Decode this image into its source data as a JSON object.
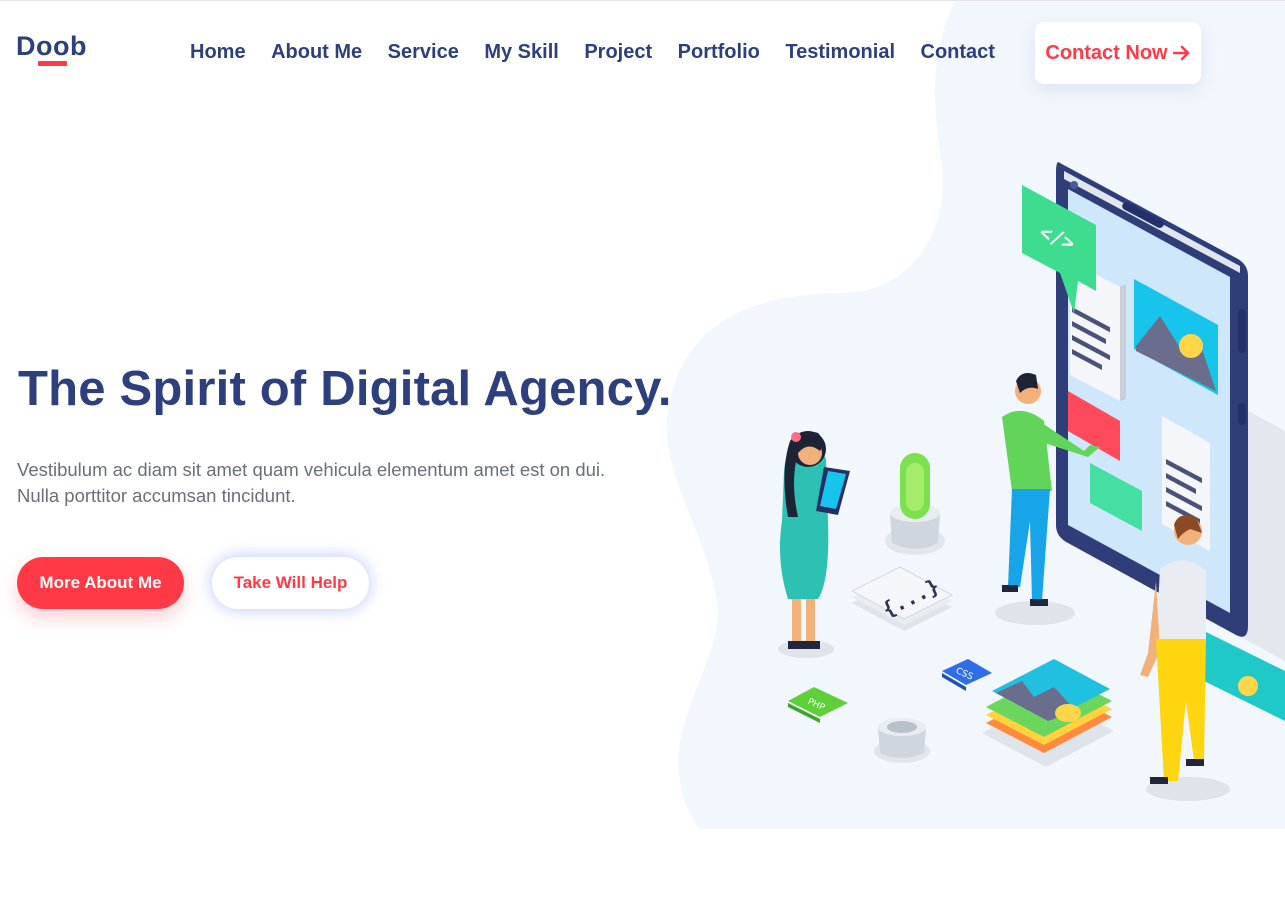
{
  "brand": {
    "name": "Doob"
  },
  "nav": {
    "items": [
      {
        "label": "Home"
      },
      {
        "label": "About Me"
      },
      {
        "label": "Service"
      },
      {
        "label": "My Skill"
      },
      {
        "label": "Project"
      },
      {
        "label": "Portfolio"
      },
      {
        "label": "Testimonial"
      },
      {
        "label": "Contact"
      }
    ],
    "cta_label": "Contact Now",
    "cta_icon": "arrow-right-icon"
  },
  "hero": {
    "title": "The Spirit of Digital Agency.",
    "description": "Vestibulum ac diam sit amet quam vehicula elementum amet est on dui. Nulla porttitor accumsan tincidunt.",
    "primary_button": "More About Me",
    "secondary_button": "Take Will Help",
    "illustration": {
      "code_tag": "</>",
      "brace_block": "{...}",
      "file_labels": [
        "CSS",
        "PHP"
      ]
    }
  },
  "colors": {
    "brand_navy": "#2d3f7c",
    "accent_red": "#ff3a46",
    "blob_bg": "#f2f7fd",
    "body_text": "#6b6f7a"
  }
}
